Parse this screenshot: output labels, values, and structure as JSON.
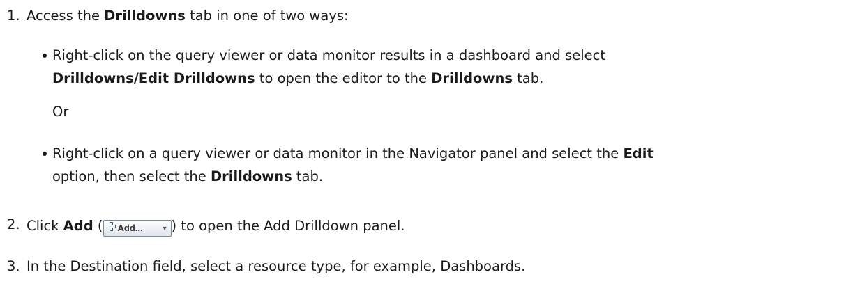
{
  "steps": [
    {
      "number": "1.",
      "parts": [
        "Access the ",
        "Drilldowns",
        " tab in one of two ways:"
      ]
    },
    {
      "number": "2.",
      "parts": [
        "Click ",
        "Add",
        " (",
        ") to open the Add Drilldown panel."
      ],
      "button_label": "Add...",
      "button_icon": "plus-icon"
    },
    {
      "number": "3.",
      "text": "In the Destination field, select a resource type, for example, Dashboards."
    }
  ],
  "bullets": [
    {
      "line1": "Right-click on the query viewer or data monitor results in a dashboard and select",
      "line2_parts": [
        "Drilldowns/Edit Drilldowns",
        " to open the editor to the ",
        "Drilldowns",
        " tab."
      ]
    },
    {
      "line1_parts": [
        "Right-click on a query viewer or data monitor in the Navigator panel and select the ",
        "Edit"
      ],
      "line2_parts": [
        "option, then select the ",
        "Drilldowns",
        " tab."
      ]
    }
  ],
  "or_text": "Or"
}
